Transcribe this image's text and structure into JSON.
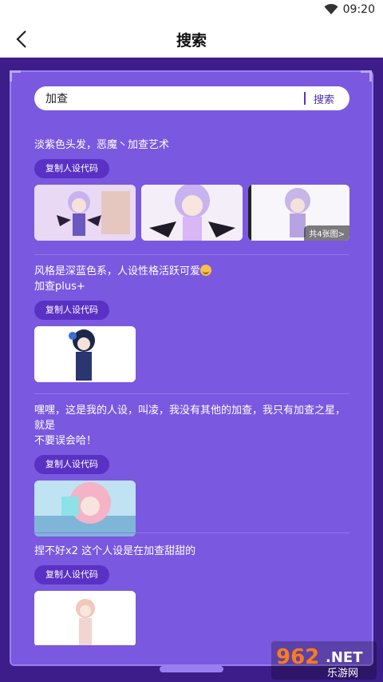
{
  "status": {
    "time": "09:20"
  },
  "header": {
    "title": "搜索"
  },
  "search": {
    "value": "加查",
    "button": "搜索"
  },
  "posts": [
    {
      "text": "淡紫色头发，恶魔丶加查艺术",
      "copy_label": "复制人设代码",
      "more_label": "共4张图>"
    },
    {
      "line1": "风格是深蓝色系，人设性格活跃可爱",
      "line2": "加查plus+",
      "copy_label": "复制人设代码"
    },
    {
      "line1": "嘿嘿，这是我的人设，叫凌，我没有其他的加查，我只有加查之星，就是",
      "line2": "不要误会哈！",
      "copy_label": "复制人设代码"
    },
    {
      "text": "捏不好x2  这个人设是在加查甜甜的",
      "copy_label": "复制人设代码"
    }
  ],
  "watermark": {
    "brand": "962",
    "suffix": ".NET",
    "sub": "乐游网"
  },
  "colors": {
    "panel": "#7a58e0",
    "frame": "#3d1d8a",
    "button": "#5a31c5"
  }
}
